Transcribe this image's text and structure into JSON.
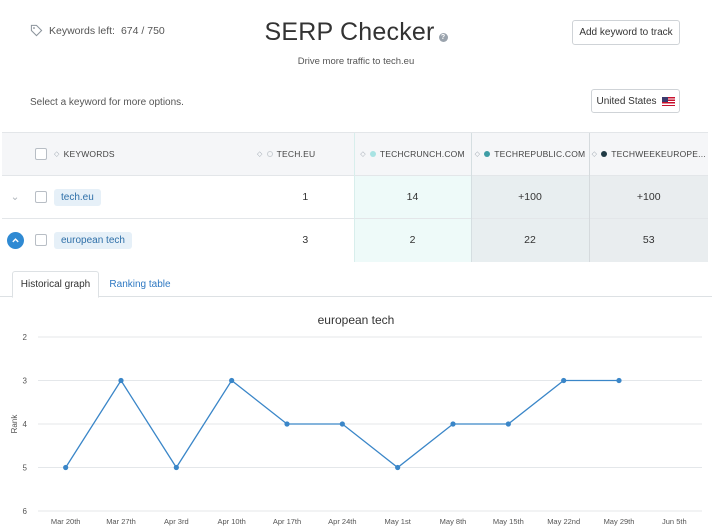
{
  "header": {
    "keywords_left_label": "Keywords left:",
    "keywords_left_value": "674 / 750",
    "title": "SERP Checker",
    "subtitle": "Drive more traffic to tech.eu",
    "add_button": "Add keyword to track",
    "country_button": "United States",
    "select_hint": "Select a keyword for more options."
  },
  "table": {
    "columns": {
      "keywords": "KEYWORDS",
      "tech_eu": "TECH.EU",
      "techcrunch": "TECHCRUNCH.COM",
      "techrepublic": "TECHREPUBLIC.COM",
      "techweekeurope": "TECHWEEKEUROPE..."
    },
    "colors": {
      "techcrunch": "#a8e3e3",
      "techrepublic": "#3e9da5",
      "techweekeurope": "#1f3a44"
    },
    "rows": [
      {
        "keyword": "tech.eu",
        "tech_eu": "1",
        "techcrunch": "14",
        "techrepublic": "+100",
        "techweekeurope": "+100"
      },
      {
        "keyword": "european tech",
        "tech_eu": "3",
        "techcrunch": "2",
        "techrepublic": "22",
        "techweekeurope": "53"
      }
    ]
  },
  "tabs": {
    "historical": "Historical graph",
    "ranking": "Ranking table"
  },
  "chart_data": {
    "type": "line",
    "title": "european tech",
    "ylabel": "Rank",
    "xlabel": "",
    "x": [
      "Mar 20th",
      "Mar 27th",
      "Apr 3rd",
      "Apr 10th",
      "Apr 17th",
      "Apr 24th",
      "May 1st",
      "May 8th",
      "May 15th",
      "May 22nd",
      "May 29th",
      "Jun 5th"
    ],
    "yticks": [
      2,
      3,
      4,
      5,
      6
    ],
    "ylim": [
      2,
      6
    ],
    "y_inverted": true,
    "series": [
      {
        "values": [
          5,
          3,
          5,
          3,
          4,
          4,
          5,
          4,
          4,
          3,
          3,
          null
        ],
        "color": "#3a86c8"
      }
    ],
    "grid": true
  }
}
